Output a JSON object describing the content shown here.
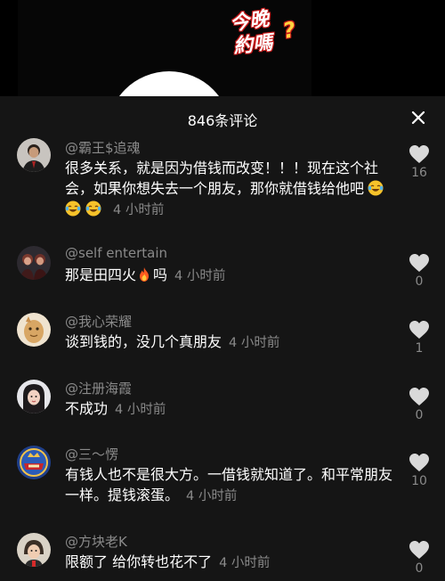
{
  "video": {
    "logo_line1": "今晚",
    "logo_line2": "約嗎",
    "logo_line3": "?"
  },
  "panel": {
    "comment_count": "846条评论",
    "close_icon": "close-icon"
  },
  "comments": [
    {
      "username": "@霸王$追魂",
      "text": "很多关系，就是因为借钱而改变！！！现在这个社会，如果你想失去一个朋友，那你就借钱给他吧",
      "emojis": [
        "laughing-crying-emoji",
        "laughing-crying-emoji",
        "laughing-crying-emoji"
      ],
      "time": "4 小时前",
      "likes": "16"
    },
    {
      "username": "@self entertain",
      "text_before": "那是田四火",
      "emoji": "fire-emoji",
      "text_after": "吗",
      "time": "4 小时前",
      "likes": "0"
    },
    {
      "username": "@我心荣耀",
      "text": "谈到钱的，没几个真朋友",
      "time": "4 小时前",
      "likes": "1"
    },
    {
      "username": "@注册海霞",
      "text": "不成功",
      "time": "4 小时前",
      "likes": "0"
    },
    {
      "username": "@三～愣",
      "text": "有钱人也不是很大方。一借钱就知道了。和平常朋友一样。提钱滚蛋。",
      "time": "4 小时前",
      "likes": "10"
    },
    {
      "username": "@方块老K",
      "text": "限额了 给你转也花不了",
      "time": "4 小时前",
      "likes": "0"
    }
  ],
  "colors": {
    "panel_bg": "#151515",
    "secondary_text": "#8a8a8a",
    "heart": "#d9d9d9"
  }
}
